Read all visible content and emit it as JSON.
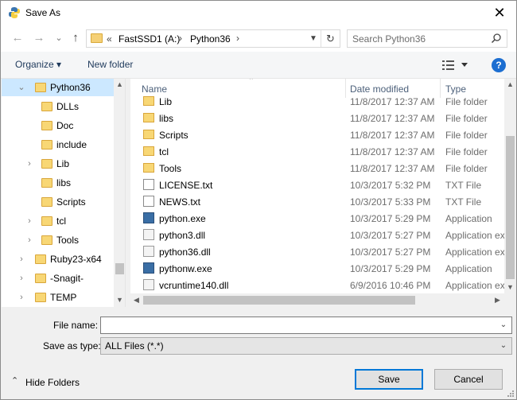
{
  "window": {
    "title": "Save As",
    "close_label": "✕"
  },
  "nav": {
    "back_label": "←",
    "forward_label": "→",
    "recent_label": "⌄",
    "up_label": "↑",
    "breadcrumb": [
      "FastSSD1 (A:)",
      "Python36"
    ],
    "overflow_label": "«",
    "separator": "›",
    "search_placeholder": "Search Python36"
  },
  "toolbar": {
    "organize": "Organize ▾",
    "new_folder": "New folder",
    "help": "?"
  },
  "tree": {
    "items": [
      {
        "label": "Python36",
        "arrow": "⌄",
        "selected": true,
        "indent": 1
      },
      {
        "label": "DLLs",
        "arrow": "",
        "indent": 2
      },
      {
        "label": "Doc",
        "arrow": "",
        "indent": 2
      },
      {
        "label": "include",
        "arrow": "",
        "indent": 2
      },
      {
        "label": "Lib",
        "arrow": "›",
        "indent": 2
      },
      {
        "label": "libs",
        "arrow": "",
        "indent": 2
      },
      {
        "label": "Scripts",
        "arrow": "",
        "indent": 2
      },
      {
        "label": "tcl",
        "arrow": "›",
        "indent": 2
      },
      {
        "label": "Tools",
        "arrow": "›",
        "indent": 2
      },
      {
        "label": "Ruby23-x64",
        "arrow": "›",
        "indent": 1
      },
      {
        "label": "-Snagit-",
        "arrow": "›",
        "indent": 1
      },
      {
        "label": "TEMP",
        "arrow": "›",
        "indent": 1
      }
    ]
  },
  "columns": {
    "name": "Name",
    "date": "Date modified",
    "type": "Type"
  },
  "files": [
    {
      "name": "Lib",
      "date": "11/8/2017 12:37 AM",
      "type": "File folder",
      "icon": "folder"
    },
    {
      "name": "libs",
      "date": "11/8/2017 12:37 AM",
      "type": "File folder",
      "icon": "folder"
    },
    {
      "name": "Scripts",
      "date": "11/8/2017 12:37 AM",
      "type": "File folder",
      "icon": "folder"
    },
    {
      "name": "tcl",
      "date": "11/8/2017 12:37 AM",
      "type": "File folder",
      "icon": "folder"
    },
    {
      "name": "Tools",
      "date": "11/8/2017 12:37 AM",
      "type": "File folder",
      "icon": "folder"
    },
    {
      "name": "LICENSE.txt",
      "date": "10/3/2017 5:32 PM",
      "type": "TXT File",
      "icon": "txt"
    },
    {
      "name": "NEWS.txt",
      "date": "10/3/2017 5:33 PM",
      "type": "TXT File",
      "icon": "txt"
    },
    {
      "name": "python.exe",
      "date": "10/3/2017 5:29 PM",
      "type": "Application",
      "icon": "exe"
    },
    {
      "name": "python3.dll",
      "date": "10/3/2017 5:27 PM",
      "type": "Application ex",
      "icon": "dll"
    },
    {
      "name": "python36.dll",
      "date": "10/3/2017 5:27 PM",
      "type": "Application ex",
      "icon": "dll"
    },
    {
      "name": "pythonw.exe",
      "date": "10/3/2017 5:29 PM",
      "type": "Application",
      "icon": "exe"
    },
    {
      "name": "vcruntime140.dll",
      "date": "6/9/2016 10:46 PM",
      "type": "Application ex",
      "icon": "dll"
    }
  ],
  "form": {
    "filename_label": "File name:",
    "filename_value": "",
    "savetype_label": "Save as type:",
    "savetype_value": "ALL Files (*.*)"
  },
  "footer": {
    "hide_folders": "Hide Folders",
    "save": "Save",
    "cancel": "Cancel"
  },
  "colors": {
    "accent": "#0078d7",
    "selection": "#cce8ff",
    "folder": "#f8d775",
    "header_text": "#4c607a"
  }
}
